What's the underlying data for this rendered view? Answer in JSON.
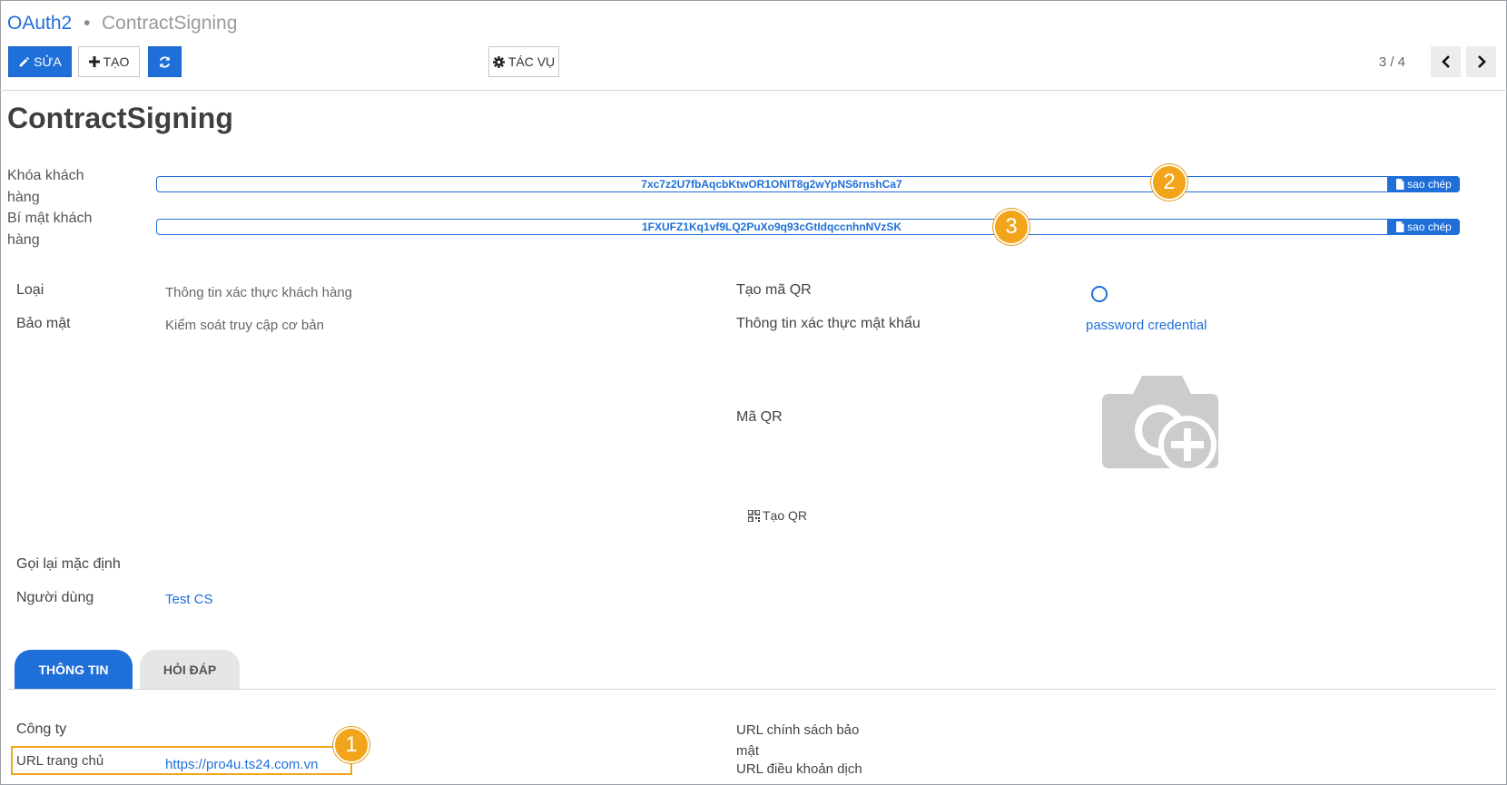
{
  "breadcrumb": {
    "root": "OAuth2",
    "separator": "•",
    "current": "ContractSigning"
  },
  "toolbar": {
    "edit_label": "SỬA",
    "create_label": "TẠO",
    "action_label": "TÁC VỤ",
    "pager": "3 / 4"
  },
  "record": {
    "title": "ContractSigning",
    "client_key": {
      "label_line1": "Khóa khách",
      "label_line2": "hàng",
      "value": "7xc7z2U7fbAqcbKtwOR1ONlT8g2wYpNS6rnshCa7",
      "copy_label": "sao chép"
    },
    "client_secret": {
      "label_line1": "Bí mật khách",
      "label_line2": "hàng",
      "value": "1FXUFZ1Kq1vf9LQ2PuXo9q93cGtIdqccnhnNVzSK",
      "copy_label": "sao chép"
    }
  },
  "fields_left": {
    "type_label": "Loại",
    "type_value": "Thông tin xác thực khách hàng",
    "security_label": "Bảo mật",
    "security_value": "Kiểm soát truy cập cơ bản",
    "callback_label": "Gọi lại mặc định",
    "user_label": "Người dùng",
    "user_value": "Test CS"
  },
  "fields_right": {
    "gen_qr_label": "Tạo mã QR",
    "password_label": "Thông tin xác thực mật khẩu",
    "password_value": "password credential",
    "qr_label": "Mã QR",
    "create_qr_label": "Tạo QR"
  },
  "tabs": [
    {
      "label": "THÔNG TIN"
    },
    {
      "label": "HỎI ĐÁP"
    }
  ],
  "info": {
    "company_label": "Công ty",
    "homepage_label": "URL trang chủ",
    "homepage_value": "https://pro4u.ts24.com.vn",
    "privacy_label_line1": "URL chính sách bảo",
    "privacy_label_line2": "mật",
    "terms_label": "URL điều khoản dịch"
  },
  "callouts": {
    "one": "1",
    "two": "2",
    "three": "3"
  },
  "colors": {
    "accent": "#1f6fd8",
    "callout": "#f2a51a"
  }
}
